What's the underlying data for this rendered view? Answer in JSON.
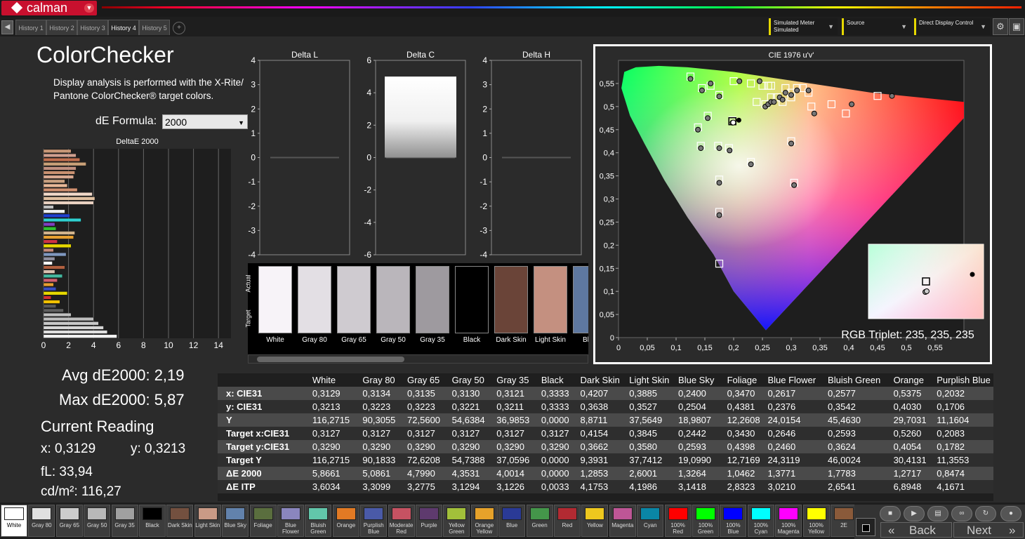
{
  "app": {
    "name": "calman"
  },
  "tabs": [
    "History 1",
    "History 2",
    "History 3",
    "History 4",
    "History 5"
  ],
  "active_tab": 3,
  "devices": [
    {
      "label": "Simulated Meter",
      "sub": "Simulated"
    },
    {
      "label": "Source",
      "sub": ""
    },
    {
      "label": "Direct Display Control",
      "sub": ""
    }
  ],
  "page": {
    "title": "ColorChecker",
    "description": "Display analysis is performed with the X-Rite/ Pantone ColorChecker® target colors.",
    "de_formula_label": "dE Formula:",
    "de_formula_value": "2000"
  },
  "summary": {
    "avg": "Avg dE2000: 2,19",
    "max": "Max dE2000: 5,87",
    "current_title": "Current Reading",
    "x": "x: 0,3129",
    "y": "y: 0,3213",
    "fl": "fL: 33,94",
    "cd": "cd/m²: 116,27"
  },
  "delta_bar_chart": {
    "title": "DeltaE 2000",
    "x_ticks": [
      "0",
      "2",
      "4",
      "6",
      "8",
      "10",
      "12",
      "14"
    ],
    "xlim": [
      0,
      15
    ],
    "values": [
      5.87,
      5.1,
      4.8,
      4.4,
      4.0,
      2.2,
      1.6,
      1.0,
      1.3,
      0.6,
      1.9,
      1.0,
      0.8,
      1.1,
      1.5,
      0.9,
      1.7,
      0.7,
      0.9,
      1.8,
      0.8,
      2.2,
      1.1,
      2.4,
      2.5,
      1.0,
      0.9,
      3.0,
      2.1,
      1.7,
      0.8,
      4.0,
      4.1,
      3.9,
      2.7,
      1.9,
      1.7,
      2.4,
      2.5,
      2.6,
      3.4,
      2.9,
      2.6,
      2.2
    ],
    "colors": [
      "#f2f2f2",
      "#e0e0e0",
      "#d6d6d6",
      "#c8c8c8",
      "#bebebe",
      "#c0c0c0",
      "#606060",
      "#5a5a5a",
      "#f2c100",
      "#d43030",
      "#e6d800",
      "#3a4fc0",
      "#e8a030",
      "#d06070",
      "#45b8a0",
      "#d8c0b0",
      "#b06040",
      "#ffffff",
      "#9090a0",
      "#8098c0",
      "#c58b7c",
      "#e6d800",
      "#cc3344",
      "#e8a030",
      "#d2b48c",
      "#30c030",
      "#8040c0",
      "#30d0d0",
      "#2040d0",
      "#f0f0f0",
      "#c0c0c0",
      "#e8d0c0",
      "#e0c0a0",
      "#f0d8c8",
      "#d09070",
      "#e8b898",
      "#c8a080",
      "#d8a890",
      "#c89070",
      "#c09080",
      "#c8a078",
      "#c07050",
      "#d0a090",
      "#c89878"
    ]
  },
  "delta_charts": [
    {
      "title": "Delta L",
      "ylim": [
        -4,
        4
      ],
      "ticks": [
        "4",
        "3",
        "2",
        "1",
        "0",
        "-1",
        "-2",
        "-3",
        "-4"
      ]
    },
    {
      "title": "Delta C",
      "ylim": [
        -6,
        6
      ],
      "ticks": [
        "6",
        "4",
        "2",
        "0",
        "-2",
        "-4",
        "-6"
      ]
    },
    {
      "title": "Delta H",
      "ylim": [
        -4,
        4
      ],
      "ticks": [
        "4",
        "3",
        "2",
        "1",
        "0",
        "-1",
        "-2",
        "-3",
        "-4"
      ]
    }
  ],
  "swatch_strip": {
    "side_top": "Actual",
    "side_bottom": "Target",
    "items": [
      {
        "label": "White",
        "color": "#f7f3f8"
      },
      {
        "label": "Gray 80",
        "color": "#e3dfe4"
      },
      {
        "label": "Gray 65",
        "color": "#cfcbd0"
      },
      {
        "label": "Gray 50",
        "color": "#bab6bb"
      },
      {
        "label": "Gray 35",
        "color": "#9e9a9f"
      },
      {
        "label": "Black",
        "color": "#000000"
      },
      {
        "label": "Dark Skin",
        "color": "#6a4438"
      },
      {
        "label": "Light Skin",
        "color": "#c49080"
      },
      {
        "label": "Blue",
        "color": "#5e78a0"
      }
    ]
  },
  "cie": {
    "title": "CIE 1976 u'v'",
    "x_ticks": [
      "0",
      "0,05",
      "0,1",
      "0,15",
      "0,2",
      "0,25",
      "0,3",
      "0,35",
      "0,4",
      "0,45",
      "0,5",
      "0,55"
    ],
    "y_ticks": [
      "0,55",
      "0,5",
      "0,45",
      "0,4",
      "0,35",
      "0,3",
      "0,25",
      "0,2",
      "0,15",
      "0,1",
      "0,05",
      "0"
    ],
    "targets": [
      [
        0.125,
        0.565
      ],
      [
        0.145,
        0.54
      ],
      [
        0.16,
        0.545
      ],
      [
        0.175,
        0.525
      ],
      [
        0.2,
        0.555
      ],
      [
        0.23,
        0.55
      ],
      [
        0.25,
        0.545
      ],
      [
        0.26,
        0.545
      ],
      [
        0.265,
        0.545
      ],
      [
        0.29,
        0.54
      ],
      [
        0.3,
        0.53
      ],
      [
        0.31,
        0.54
      ],
      [
        0.32,
        0.54
      ],
      [
        0.33,
        0.53
      ],
      [
        0.24,
        0.51
      ],
      [
        0.255,
        0.505
      ],
      [
        0.265,
        0.52
      ],
      [
        0.275,
        0.52
      ],
      [
        0.285,
        0.51
      ],
      [
        0.3,
        0.52
      ],
      [
        0.335,
        0.5
      ],
      [
        0.37,
        0.505
      ],
      [
        0.45,
        0.523
      ],
      [
        0.395,
        0.485
      ],
      [
        0.155,
        0.48
      ],
      [
        0.138,
        0.455
      ],
      [
        0.143,
        0.415
      ],
      [
        0.173,
        0.415
      ],
      [
        0.192,
        0.41
      ],
      [
        0.198,
        0.47
      ],
      [
        0.23,
        0.38
      ],
      [
        0.3,
        0.425
      ],
      [
        0.175,
        0.342
      ],
      [
        0.175,
        0.272
      ],
      [
        0.175,
        0.16
      ],
      [
        0.305,
        0.335
      ]
    ],
    "measured": [
      [
        0.125,
        0.56
      ],
      [
        0.145,
        0.535
      ],
      [
        0.16,
        0.55
      ],
      [
        0.175,
        0.522
      ],
      [
        0.21,
        0.555
      ],
      [
        0.245,
        0.555
      ],
      [
        0.255,
        0.5
      ],
      [
        0.26,
        0.505
      ],
      [
        0.265,
        0.51
      ],
      [
        0.27,
        0.51
      ],
      [
        0.28,
        0.52
      ],
      [
        0.285,
        0.515
      ],
      [
        0.29,
        0.53
      ],
      [
        0.3,
        0.525
      ],
      [
        0.31,
        0.535
      ],
      [
        0.33,
        0.535
      ],
      [
        0.34,
        0.485
      ],
      [
        0.405,
        0.505
      ],
      [
        0.475,
        0.523
      ],
      [
        0.155,
        0.475
      ],
      [
        0.138,
        0.45
      ],
      [
        0.143,
        0.41
      ],
      [
        0.175,
        0.41
      ],
      [
        0.193,
        0.405
      ],
      [
        0.198,
        0.465
      ],
      [
        0.23,
        0.375
      ],
      [
        0.3,
        0.42
      ],
      [
        0.175,
        0.335
      ],
      [
        0.175,
        0.265
      ],
      [
        0.305,
        0.33
      ]
    ],
    "white_target": [
      0.1978,
      0.4683
    ],
    "white_measured": [
      0.1993,
      0.4653
    ],
    "reference_point": [
      0.209,
      0.4705
    ],
    "inset_label": "RGB Triplet: 235, 235, 235"
  },
  "table": {
    "headers": [
      "",
      "White",
      "Gray 80",
      "Gray 65",
      "Gray 50",
      "Gray 35",
      "Black",
      "Dark Skin",
      "Light Skin",
      "Blue Sky",
      "Foliage",
      "Blue Flower",
      "Bluish Green",
      "Orange",
      "Purplish Blue"
    ],
    "rows": [
      [
        "x: CIE31",
        "0,3129",
        "0,3134",
        "0,3135",
        "0,3130",
        "0,3121",
        "0,3333",
        "0,4207",
        "0,3885",
        "0,2400",
        "0,3470",
        "0,2617",
        "0,2577",
        "0,5375",
        "0,2032"
      ],
      [
        "y: CIE31",
        "0,3213",
        "0,3223",
        "0,3223",
        "0,3221",
        "0,3211",
        "0,3333",
        "0,3638",
        "0,3527",
        "0,2504",
        "0,4381",
        "0,2376",
        "0,3542",
        "0,4030",
        "0,1706"
      ],
      [
        "Y",
        "116,2715",
        "90,3055",
        "72,5600",
        "54,6384",
        "36,9853",
        "0,0000",
        "8,8711",
        "37,5649",
        "18,9807",
        "12,2608",
        "24,0154",
        "45,4630",
        "29,7031",
        "11,1604"
      ],
      [
        "Target x:CIE31",
        "0,3127",
        "0,3127",
        "0,3127",
        "0,3127",
        "0,3127",
        "0,3127",
        "0,4154",
        "0,3845",
        "0,2442",
        "0,3430",
        "0,2646",
        "0,2593",
        "0,5260",
        "0,2083"
      ],
      [
        "Target y:CIE31",
        "0,3290",
        "0,3290",
        "0,3290",
        "0,3290",
        "0,3290",
        "0,3290",
        "0,3662",
        "0,3580",
        "0,2593",
        "0,4398",
        "0,2460",
        "0,3624",
        "0,4054",
        "0,1782"
      ],
      [
        "Target Y",
        "116,2715",
        "90,1833",
        "72,6208",
        "54,7388",
        "37,0596",
        "0,0000",
        "9,3931",
        "37,7412",
        "19,0990",
        "12,7169",
        "24,3119",
        "46,0024",
        "30,4131",
        "11,3553"
      ],
      [
        "ΔE 2000",
        "5,8661",
        "5,0861",
        "4,7990",
        "4,3531",
        "4,0014",
        "0,0000",
        "1,2853",
        "2,6001",
        "1,3264",
        "1,0462",
        "1,3771",
        "1,7783",
        "1,2717",
        "0,8474"
      ],
      [
        "ΔE ITP",
        "3,6034",
        "3,3099",
        "3,2775",
        "3,1294",
        "3,1226",
        "0,0033",
        "4,1753",
        "4,1986",
        "3,1418",
        "2,8323",
        "3,0210",
        "2,6541",
        "6,8948",
        "4,1671"
      ]
    ]
  },
  "bottom_swatches": [
    {
      "label": "White",
      "color": "#ffffff"
    },
    {
      "label": "Gray 80",
      "color": "#e0e0e0"
    },
    {
      "label": "Gray 65",
      "color": "#cccccc"
    },
    {
      "label": "Gray 50",
      "color": "#b8b8b8"
    },
    {
      "label": "Gray 35",
      "color": "#a0a0a0"
    },
    {
      "label": "Black",
      "color": "#000000"
    },
    {
      "label": "Dark Skin",
      "color": "#73503f"
    },
    {
      "label": "Light Skin",
      "color": "#c99a86"
    },
    {
      "label": "Blue Sky",
      "color": "#6282ac"
    },
    {
      "label": "Foliage",
      "color": "#5a6e3e"
    },
    {
      "label": "Blue Flower",
      "color": "#8a86be"
    },
    {
      "label": "Bluish Green",
      "color": "#62c6aa"
    },
    {
      "label": "Orange",
      "color": "#e27a24"
    },
    {
      "label": "Purplish Blue",
      "color": "#4a5aa8"
    },
    {
      "label": "Moderate Red",
      "color": "#c65262"
    },
    {
      "label": "Purple",
      "color": "#5e3a6e"
    },
    {
      "label": "Yellow Green",
      "color": "#a2c03a"
    },
    {
      "label": "Orange Yellow",
      "color": "#e6a22a"
    },
    {
      "label": "Blue",
      "color": "#2a3a96"
    },
    {
      "label": "Green",
      "color": "#44964a"
    },
    {
      "label": "Red",
      "color": "#b22a32"
    },
    {
      "label": "Yellow",
      "color": "#eec81e"
    },
    {
      "label": "Magenta",
      "color": "#be5696"
    },
    {
      "label": "Cyan",
      "color": "#0a86a6"
    },
    {
      "label": "100% Red",
      "color": "#ff0000"
    },
    {
      "label": "100% Green",
      "color": "#00ff00"
    },
    {
      "label": "100% Blue",
      "color": "#0000ff"
    },
    {
      "label": "100% Cyan",
      "color": "#00ffff"
    },
    {
      "label": "100% Magenta",
      "color": "#ff00ff"
    },
    {
      "label": "100% Yellow",
      "color": "#ffff00"
    },
    {
      "label": "2E",
      "color": "#8a5a3a"
    }
  ],
  "nav": {
    "back": "Back",
    "next": "Next"
  }
}
